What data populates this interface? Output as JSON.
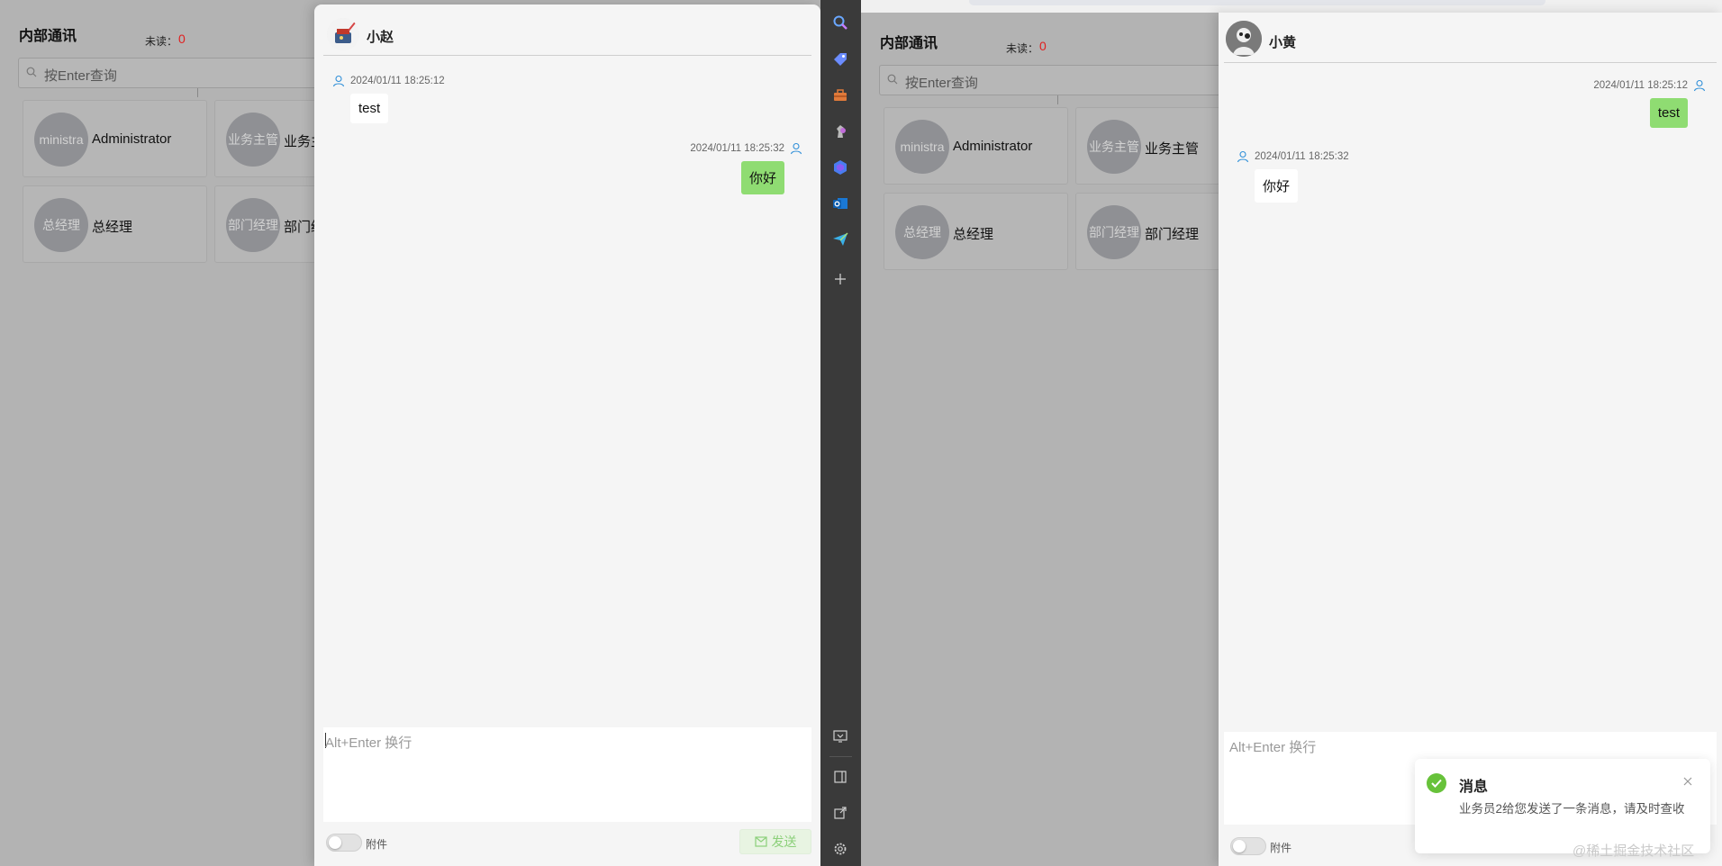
{
  "left_window": {
    "contacts": {
      "title": "内部通讯",
      "unread_label": "未读：",
      "unread_count": "0",
      "search_placeholder": "按Enter查询",
      "cards": [
        {
          "avatar_text": "ministra",
          "name": "Administrator"
        },
        {
          "avatar_text": "业务主管",
          "name": "业务主"
        },
        {
          "avatar_text": "总经理",
          "name": "总经理"
        },
        {
          "avatar_text": "部门经理",
          "name": "部门经"
        }
      ]
    },
    "chat": {
      "contact_name": "小赵",
      "messages": [
        {
          "side": "left",
          "time": "2024/01/11 18:25:12",
          "text": "test"
        },
        {
          "side": "right",
          "time": "2024/01/11 18:25:32",
          "text": "你好"
        }
      ],
      "input_placeholder": "Alt+Enter 换行",
      "attach_label": "附件",
      "send_label": "发送"
    }
  },
  "sidebar": {
    "icons": [
      "search-icon",
      "tag-icon",
      "toolbox-icon",
      "chess-icon",
      "copilot-icon",
      "outlook-icon",
      "send-icon",
      "add-icon",
      "screenshot-icon",
      "panel-icon",
      "external-link-icon",
      "settings-icon"
    ]
  },
  "right_window": {
    "contacts": {
      "title": "内部通讯",
      "unread_label": "未读：",
      "unread_count": "0",
      "search_placeholder": "按Enter查询",
      "cards": [
        {
          "avatar_text": "ministra",
          "name": "Administrator"
        },
        {
          "avatar_text": "业务主管",
          "name": "业务主管"
        },
        {
          "avatar_text": "总经理",
          "name": "总经理"
        },
        {
          "avatar_text": "部门经理",
          "name": "部门经理"
        }
      ]
    },
    "chat": {
      "contact_name": "小黄",
      "messages": [
        {
          "side": "right",
          "time": "2024/01/11 18:25:12",
          "text": "test"
        },
        {
          "side": "left",
          "time": "2024/01/11 18:25:32",
          "text": "你好"
        }
      ],
      "input_placeholder": "Alt+Enter 换行",
      "attach_label": "附件"
    }
  },
  "notification": {
    "title": "消息",
    "body": "业务员2给您发送了一条消息，请及时查收",
    "status_color": "#67c23a"
  },
  "watermark": "@稀土掘金技术社区"
}
